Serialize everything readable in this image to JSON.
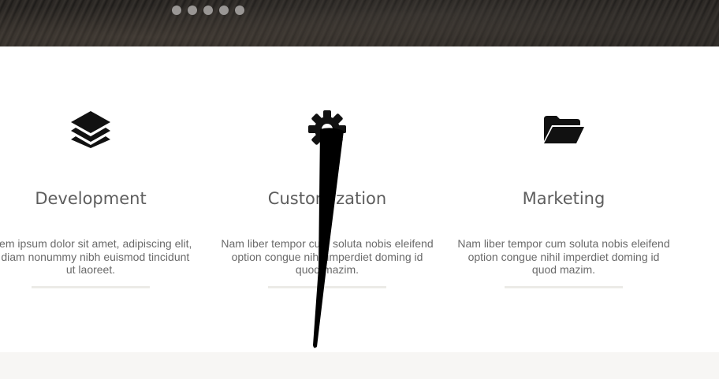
{
  "slider": {
    "dots": [
      "1",
      "2",
      "3",
      "4",
      "5"
    ]
  },
  "features": [
    {
      "icon": "layers-icon",
      "title": "Development",
      "text_lines": [
        "orem ipsum dolor sit amet, adipiscing elit,",
        "d diam nonummy nibh euismod tincidunt",
        "ut laoreet."
      ]
    },
    {
      "icon": "gear-icon",
      "title": "Customization",
      "text_lines": [
        "Nam liber tempor cum soluta nobis eleifend",
        "option congue nihil imperdiet doming id",
        "quod mazim."
      ]
    },
    {
      "icon": "folder-open-icon",
      "title": "Marketing",
      "text_lines": [
        "Nam liber tempor cum soluta nobis eleifend",
        "option congue nihil imperdiet doming id",
        "quod mazim."
      ]
    }
  ],
  "colors": {
    "hero": "#2a2623",
    "heading": "#5d5d5d",
    "body_text": "#6a6a6a",
    "rule": "#ecebe7",
    "footer_band": "#f7f6f4"
  }
}
